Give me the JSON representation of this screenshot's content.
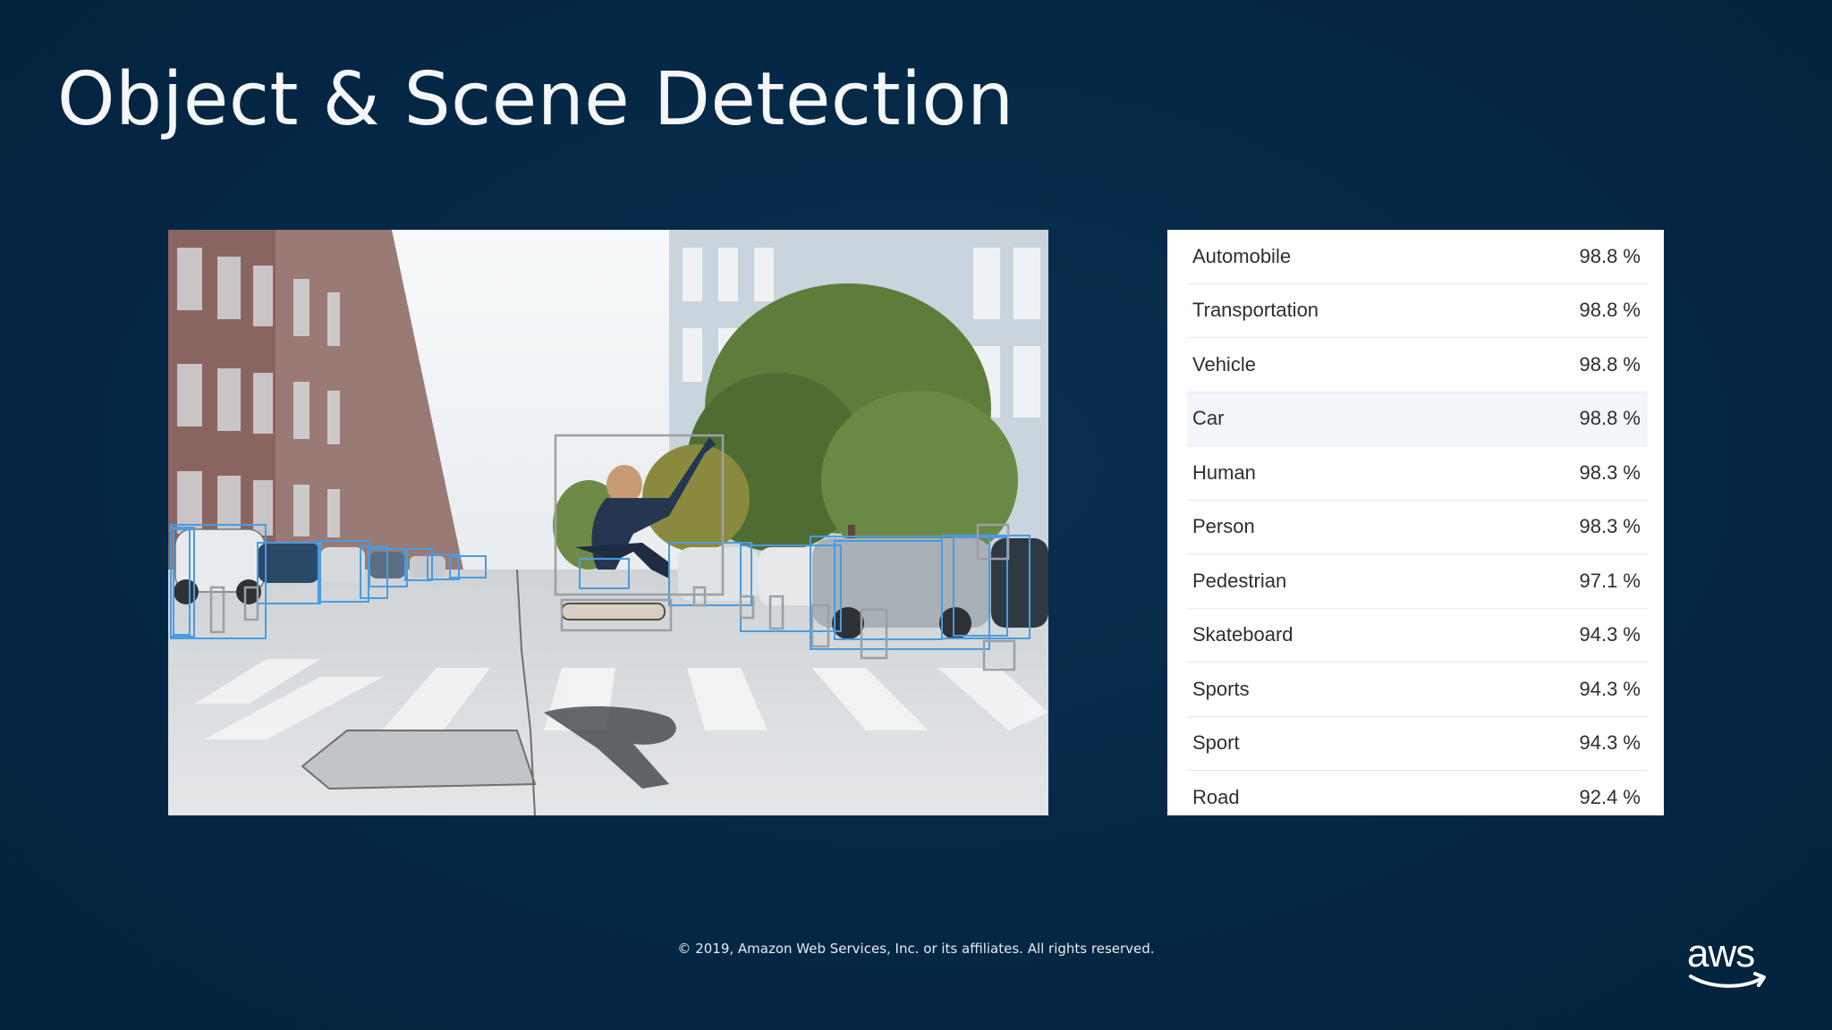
{
  "slide": {
    "title": "Object & Scene Detection",
    "footer": "© 2019, Amazon Web Services, Inc. or its affiliates. All rights reserved.",
    "logo_text": "aws"
  },
  "detections": [
    {
      "label": "Automobile",
      "confidence": "98.8 %"
    },
    {
      "label": "Transportation",
      "confidence": "98.8 %"
    },
    {
      "label": "Vehicle",
      "confidence": "98.8 %"
    },
    {
      "label": "Car",
      "confidence": "98.8 %"
    },
    {
      "label": "Human",
      "confidence": "98.3 %"
    },
    {
      "label": "Person",
      "confidence": "98.3 %"
    },
    {
      "label": "Pedestrian",
      "confidence": "97.1 %"
    },
    {
      "label": "Skateboard",
      "confidence": "94.3 %"
    },
    {
      "label": "Sports",
      "confidence": "94.3 %"
    },
    {
      "label": "Sport",
      "confidence": "94.3 %"
    },
    {
      "label": "Road",
      "confidence": "92.4 %"
    }
  ],
  "colors": {
    "background": "#032847",
    "box_blue": "#4a9be0",
    "box_gray": "#9aa0a6",
    "aws_smile": "#ffffff"
  }
}
